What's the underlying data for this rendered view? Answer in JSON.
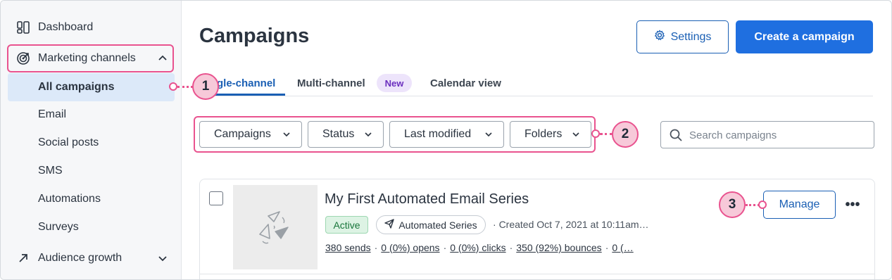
{
  "sidebar": {
    "items": [
      {
        "label": "Dashboard",
        "icon": "dashboard-icon"
      },
      {
        "label": "Marketing channels",
        "icon": "target-icon"
      },
      {
        "label": "Audience growth",
        "icon": "arrow-up-right-icon"
      }
    ],
    "sub_items": [
      "All campaigns",
      "Email",
      "Social posts",
      "SMS",
      "Automations",
      "Surveys"
    ]
  },
  "header": {
    "title": "Campaigns",
    "settings_label": "Settings",
    "create_label": "Create a campaign"
  },
  "tabs": [
    {
      "label": "gle-channel"
    },
    {
      "label": "Multi-channel"
    },
    {
      "label": "Calendar view"
    }
  ],
  "new_badge": "New",
  "filters": [
    "Campaigns",
    "Status",
    "Last modified",
    "Folders"
  ],
  "search": {
    "placeholder": "Search campaigns"
  },
  "campaign": {
    "title": "My First Automated Email Series",
    "status": "Active",
    "type": "Automated Series",
    "created": "Created Oct 7, 2021 at 10:11am…",
    "stats": {
      "sends": "380 sends",
      "opens": "0 (0%) opens",
      "clicks": "0 (0%) clicks",
      "bounces": "350 (92%) bounces",
      "more": "0 (…"
    },
    "manage_label": "Manage",
    "more_label": "•••"
  },
  "callouts": [
    "1",
    "2",
    "3"
  ],
  "colors": {
    "accent": "#1f6fe0",
    "highlight": "#e9538f",
    "active_nav_bg": "#dce9f9"
  }
}
